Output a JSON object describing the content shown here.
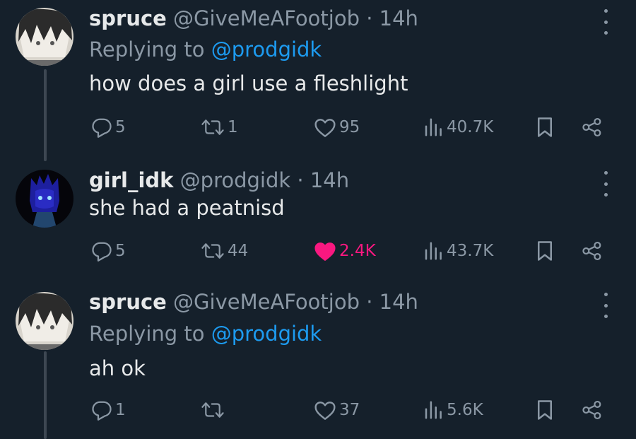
{
  "tweets": [
    {
      "name": "spruce",
      "handle": "@GiveMeAFootjob",
      "separator": "·",
      "time": "14h",
      "replying_label": "Replying to",
      "replying_to": "@prodgidk",
      "text": "how does a girl use a fleshlight",
      "replies": "5",
      "retweets": "1",
      "likes": "95",
      "views": "40.7K",
      "liked": false
    },
    {
      "name": "girl_idk",
      "handle": "@prodgidk",
      "separator": "·",
      "time": "14h",
      "text": "she had a peatnisd",
      "replies": "5",
      "retweets": "44",
      "likes": "2.4K",
      "views": "43.7K",
      "liked": true
    },
    {
      "name": "spruce",
      "handle": "@GiveMeAFootjob",
      "separator": "·",
      "time": "14h",
      "replying_label": "Replying to",
      "replying_to": "@prodgidk",
      "text": "ah ok",
      "replies": "1",
      "retweets": "",
      "likes": "37",
      "views": "5.6K",
      "liked": false
    }
  ],
  "colors": {
    "background": "#15202b",
    "text": "#e7e9ea",
    "muted": "#8b98a5",
    "link": "#1d9bf0",
    "like": "#f91880"
  },
  "icons": [
    "reply-icon",
    "retweet-icon",
    "like-icon",
    "views-icon",
    "bookmark-icon",
    "share-icon",
    "more-icon"
  ]
}
